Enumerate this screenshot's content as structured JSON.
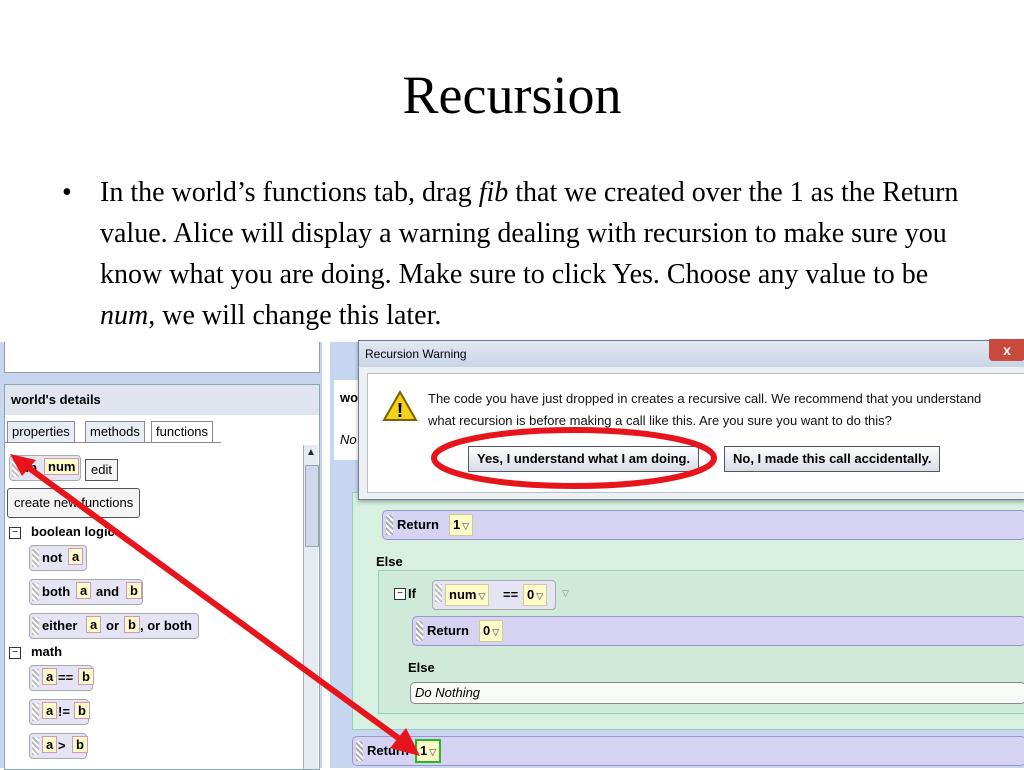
{
  "slide": {
    "title": "Recursion",
    "bullet_mark": "•",
    "bullet_part1": "In the world’s functions tab, drag ",
    "bullet_italic1": "fib",
    "bullet_part2": " that we created over the 1 as the Return value. Alice will display a warning dealing with recursion to make sure you know what you are doing. Make sure to click Yes. Choose any value to be ",
    "bullet_italic2": "num",
    "bullet_part3": ", we will change this later."
  },
  "left_panel": {
    "header": "world's details",
    "tabs": [
      "properties",
      "methods",
      "functions"
    ],
    "function_tile": {
      "name": "fib",
      "param": "num"
    },
    "edit_label": "edit",
    "create_label": "create new functions",
    "groups": [
      {
        "label": "boolean logic",
        "toggle": "−"
      },
      {
        "label": "math",
        "toggle": "−"
      }
    ],
    "boolean_tiles": [
      {
        "parts": [
          "not",
          "a"
        ]
      },
      {
        "parts": [
          "both",
          "a",
          "and",
          "b"
        ]
      },
      {
        "parts": [
          "either",
          "a",
          "or",
          "b",
          ", or both"
        ]
      }
    ],
    "math_tiles": [
      {
        "parts": [
          "a",
          "==",
          "b"
        ]
      },
      {
        "parts": [
          "a",
          "!=",
          "b"
        ]
      },
      {
        "parts": [
          "a",
          ">",
          "b"
        ]
      }
    ]
  },
  "editor": {
    "header_fragment": "wo",
    "side_fragment": "No",
    "return1": {
      "label": "Return",
      "value": "1"
    },
    "else1": "Else",
    "if_label": "If",
    "if_cond": {
      "left": "num",
      "op": "==",
      "right": "0"
    },
    "return0": {
      "label": "Return",
      "value": "0"
    },
    "else2": "Else",
    "do_nothing": "Do Nothing",
    "return_bottom": {
      "label": "Return",
      "value": "1"
    }
  },
  "dialog": {
    "title": "Recursion Warning",
    "close_glyph": "x",
    "message_line1": "The code you have just dropped in creates a recursive call. We recommend that you understand",
    "message_line2": "what recursion is before making a call like this.  Are you sure you want to do this?",
    "yes_label": "Yes, I understand what I am doing.",
    "no_label": "No, I made this call accidentally.",
    "warning_glyph": "!"
  },
  "colors": {
    "annotation_red": "#e8141c",
    "highlight_green": "#22bb22"
  }
}
